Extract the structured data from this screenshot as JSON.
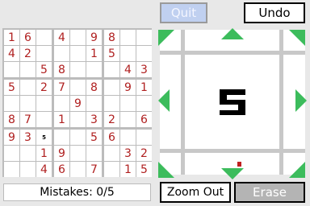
{
  "buttons": {
    "quit": "Quit",
    "undo": "Undo",
    "zoom_out": "Zoom Out",
    "erase": "Erase"
  },
  "status": {
    "mistakes": "Mistakes: 0/5"
  },
  "zoom_view": {
    "digit": "5"
  },
  "colors": {
    "given": "#b02020",
    "note": "#000000",
    "arrow": "#3cbc5c",
    "grid": "#bcbcbc"
  },
  "board": {
    "rows": [
      [
        "1",
        "6",
        "",
        "4",
        "",
        "9",
        "8",
        "",
        ""
      ],
      [
        "4",
        "2",
        "",
        "",
        "",
        "1",
        "5",
        "",
        ""
      ],
      [
        "",
        "",
        "5",
        "8",
        "",
        "",
        "",
        "4",
        "3"
      ],
      [
        "5",
        "",
        "2",
        "7",
        "",
        "8",
        "",
        "9",
        "1"
      ],
      [
        "",
        "",
        "",
        "",
        "9",
        "",
        "",
        "",
        ""
      ],
      [
        "8",
        "7",
        "",
        "1",
        "",
        "3",
        "2",
        "",
        "6"
      ],
      [
        "9",
        "3",
        "",
        "",
        "",
        "5",
        "6",
        "",
        ""
      ],
      [
        "",
        "",
        "1",
        "9",
        "",
        "",
        "",
        "3",
        "2"
      ],
      [
        "",
        "",
        "4",
        "6",
        "",
        "7",
        "",
        "1",
        "5"
      ]
    ],
    "notes": [
      {
        "row": 6,
        "col": 2,
        "text": "5"
      }
    ]
  },
  "arrows": [
    "up-left",
    "up",
    "up-right",
    "left",
    "right",
    "down-left",
    "down",
    "down-right"
  ]
}
